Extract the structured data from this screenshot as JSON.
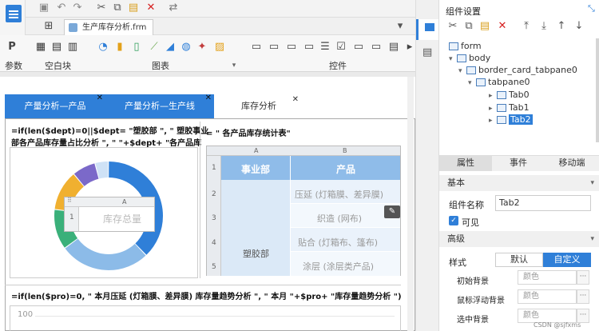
{
  "top_toolbar": {
    "doc_tab_label": "生产库存分析.frm"
  },
  "ribbon": {
    "groups": [
      {
        "label": "参数"
      },
      {
        "label": "空白块"
      },
      {
        "label": "图表"
      },
      {
        "label": "控件"
      }
    ]
  },
  "report": {
    "tabs": [
      {
        "label": "产量分析—产品",
        "active": false
      },
      {
        "label": "产量分析—生产线",
        "active": false
      },
      {
        "label": "库存分析",
        "active": true
      }
    ],
    "formula_top_line1": "=if(len($dept)=0||$dept= \"塑胶部 \", \"  塑胶事业",
    "formula_top_line2": "部各产品库存量占比分析 \", \"  \"+$dept+ \"各产品库",
    "formula_right_title": "= \"  各产品库存统计表\"",
    "formula_bottom": "=if(len($pro)=0, \"  本月压延 (灯箱膜、差异膜) 库存量趋势分析 \", \"  本月 \"+$pro+ \"库存量趋势分析 \")",
    "bottom_axis_value": "100",
    "mini_table": {
      "col_header": "A",
      "row_header": "1",
      "cell": "库存总量"
    },
    "stat_table": {
      "col_headers": [
        "A",
        "B"
      ],
      "row_headers": [
        "1",
        "2",
        "3",
        "4",
        "5"
      ],
      "header_cells": [
        "事业部",
        "产品"
      ],
      "merged_cell": "塑胶部",
      "products": [
        "压延 (灯箱膜、差异膜)",
        "织造 (网布)",
        "贴合 (灯箱布、篷布)",
        "涂层 (涂层类产品)"
      ]
    },
    "donut_segments": [
      {
        "color": "#2f7fd8",
        "fraction": 0.38
      },
      {
        "color": "#8cbbe8",
        "fraction": 0.27
      },
      {
        "color": "#3ab07a",
        "fraction": 0.12
      },
      {
        "color": "#f0b030",
        "fraction": 0.12
      },
      {
        "color": "#7b69c9",
        "fraction": 0.07
      },
      {
        "color": "#cfe2f6",
        "fraction": 0.04
      }
    ]
  },
  "right_panel": {
    "title": "组件设置",
    "tree": [
      {
        "label": "form",
        "level": 0
      },
      {
        "label": "body",
        "level": 1
      },
      {
        "label": "border_card_tabpane0",
        "level": 2
      },
      {
        "label": "tabpane0",
        "level": 3
      },
      {
        "label": "Tab0",
        "level": 4
      },
      {
        "label": "Tab1",
        "level": 4
      },
      {
        "label": "Tab2",
        "level": 4,
        "selected": true
      }
    ],
    "prop_tabs": [
      "属性",
      "事件",
      "移动端"
    ],
    "section_basic": "基本",
    "component_name_label": "组件名称",
    "component_name_value": "Tab2",
    "visible_label": "可见",
    "visible_checked": true,
    "section_advanced": "高级",
    "style_label": "样式",
    "style_default": "默认",
    "style_custom": "自定义",
    "initial_bg_label": "初始背景",
    "hover_bg_label": "鼠标浮动背景",
    "selected_bg_label": "选中背景",
    "color_placeholder": "颜色",
    "watermark": "CSDN @sjfxms"
  }
}
